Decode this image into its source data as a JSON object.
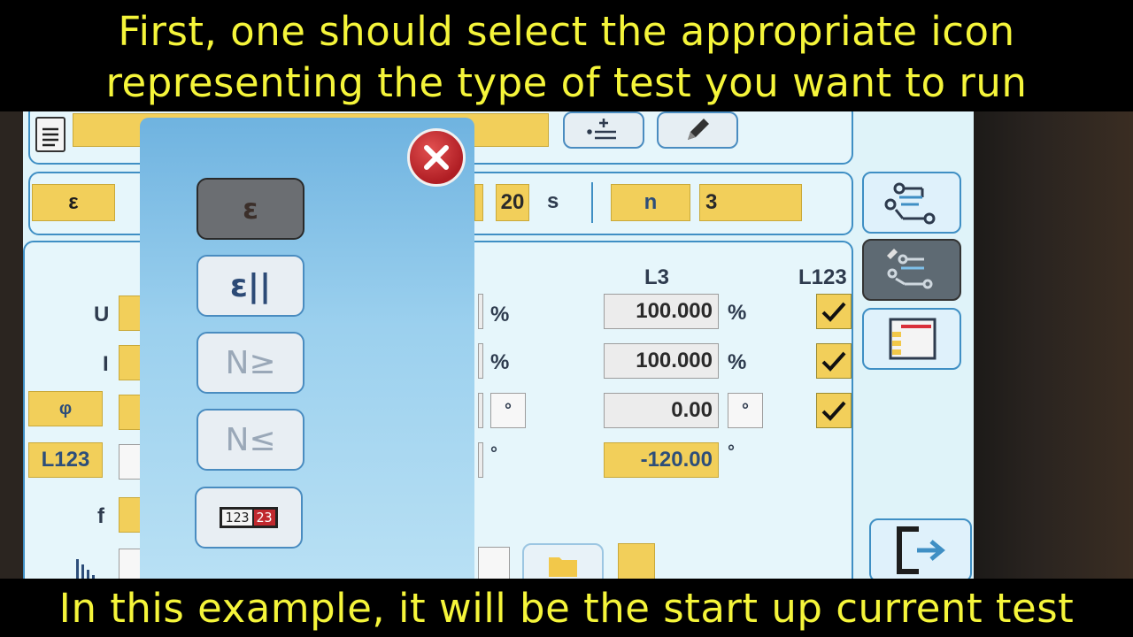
{
  "captions": {
    "top_line1": "First, one should select the appropriate icon",
    "top_line2": "representing the type of test you want to run",
    "bottom": "In this example, it will be the start up current test"
  },
  "header": {
    "epsilon_tab": "ε",
    "time_value": "20",
    "time_unit": "s",
    "n_label": "n",
    "n_value": "3"
  },
  "table": {
    "col_l3": "L3",
    "col_l123": "L123",
    "rows": [
      {
        "label": "U",
        "l3_value": "100.000",
        "unit": "%",
        "left_unit": "%",
        "checked": true
      },
      {
        "label": "I",
        "l3_value": "100.000",
        "unit": "%",
        "left_unit": "%",
        "checked": true
      },
      {
        "label": "φ",
        "l3_value": "0.00",
        "unit": "°",
        "left_unit": "°",
        "checked": true
      },
      {
        "label": "L123",
        "l3_value": "-120.00",
        "unit": "°",
        "left_unit": "°"
      },
      {
        "label": "f"
      }
    ]
  },
  "popup": {
    "options": [
      {
        "label": "ε",
        "icon": "epsilon-icon",
        "selected": true
      },
      {
        "label": "ε||",
        "icon": "epsilon-parallel-icon"
      },
      {
        "label": "N≥",
        "icon": "n-greater-equal-icon"
      },
      {
        "label": "N≤",
        "icon": "n-less-equal-icon"
      },
      {
        "label": "123 23",
        "icon": "counter-icon"
      }
    ]
  },
  "colors": {
    "caption": "#f5f53a",
    "field_yellow": "#f2cf5a",
    "panel_border": "#3f8fc4",
    "close_red": "#c0282e"
  }
}
